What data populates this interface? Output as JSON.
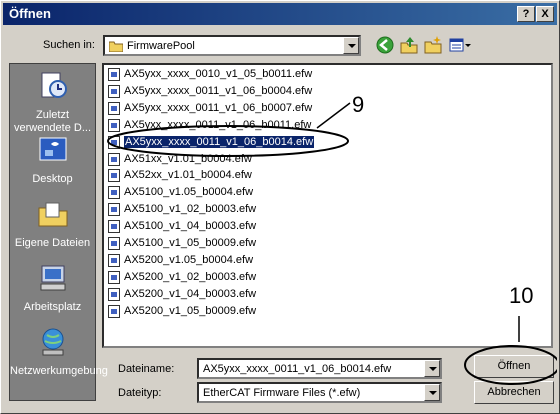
{
  "window": {
    "title": "Öffnen",
    "help_glyph": "?",
    "close_glyph": "X"
  },
  "lookin": {
    "label": "Suchen in:",
    "value": "FirmwarePool"
  },
  "places": [
    {
      "label": "Zuletzt verwendete D...",
      "icon": "recent-documents-icon"
    },
    {
      "label": "Desktop",
      "icon": "desktop-icon"
    },
    {
      "label": "Eigene Dateien",
      "icon": "my-documents-icon"
    },
    {
      "label": "Arbeitsplatz",
      "icon": "my-computer-icon"
    },
    {
      "label": "Netzwerkumgebung",
      "icon": "network-icon"
    }
  ],
  "files": [
    "AX5yxx_xxxx_0010_v1_05_b0011.efw",
    "AX5yxx_xxxx_0011_v1_06_b0004.efw",
    "AX5yxx_xxxx_0011_v1_06_b0007.efw",
    "AX5yxx_xxxx_0011_v1_06_b0011.efw",
    "AX5yxx_xxxx_0011_v1_06_b0014.efw",
    "AX51xx_v1.01_b0004.efw",
    "AX52xx_v1.01_b0004.efw",
    "AX5100_v1.05_b0004.efw",
    "AX5100_v1_02_b0003.efw",
    "AX5100_v1_04_b0003.efw",
    "AX5100_v1_05_b0009.efw",
    "AX5200_v1.05_b0004.efw",
    "AX5200_v1_02_b0003.efw",
    "AX5200_v1_04_b0003.efw",
    "AX5200_v1_05_b0009.efw"
  ],
  "selected_index": 4,
  "filename": {
    "label": "Dateiname:",
    "value": "AX5yxx_xxxx_0011_v1_06_b0014.efw"
  },
  "filetype": {
    "label": "Dateityp:",
    "value": "EtherCAT Firmware Files (*.efw)"
  },
  "buttons": {
    "open": "Öffnen",
    "cancel": "Abbrechen"
  },
  "annotations": {
    "file_callout": "9",
    "open_callout": "10"
  }
}
